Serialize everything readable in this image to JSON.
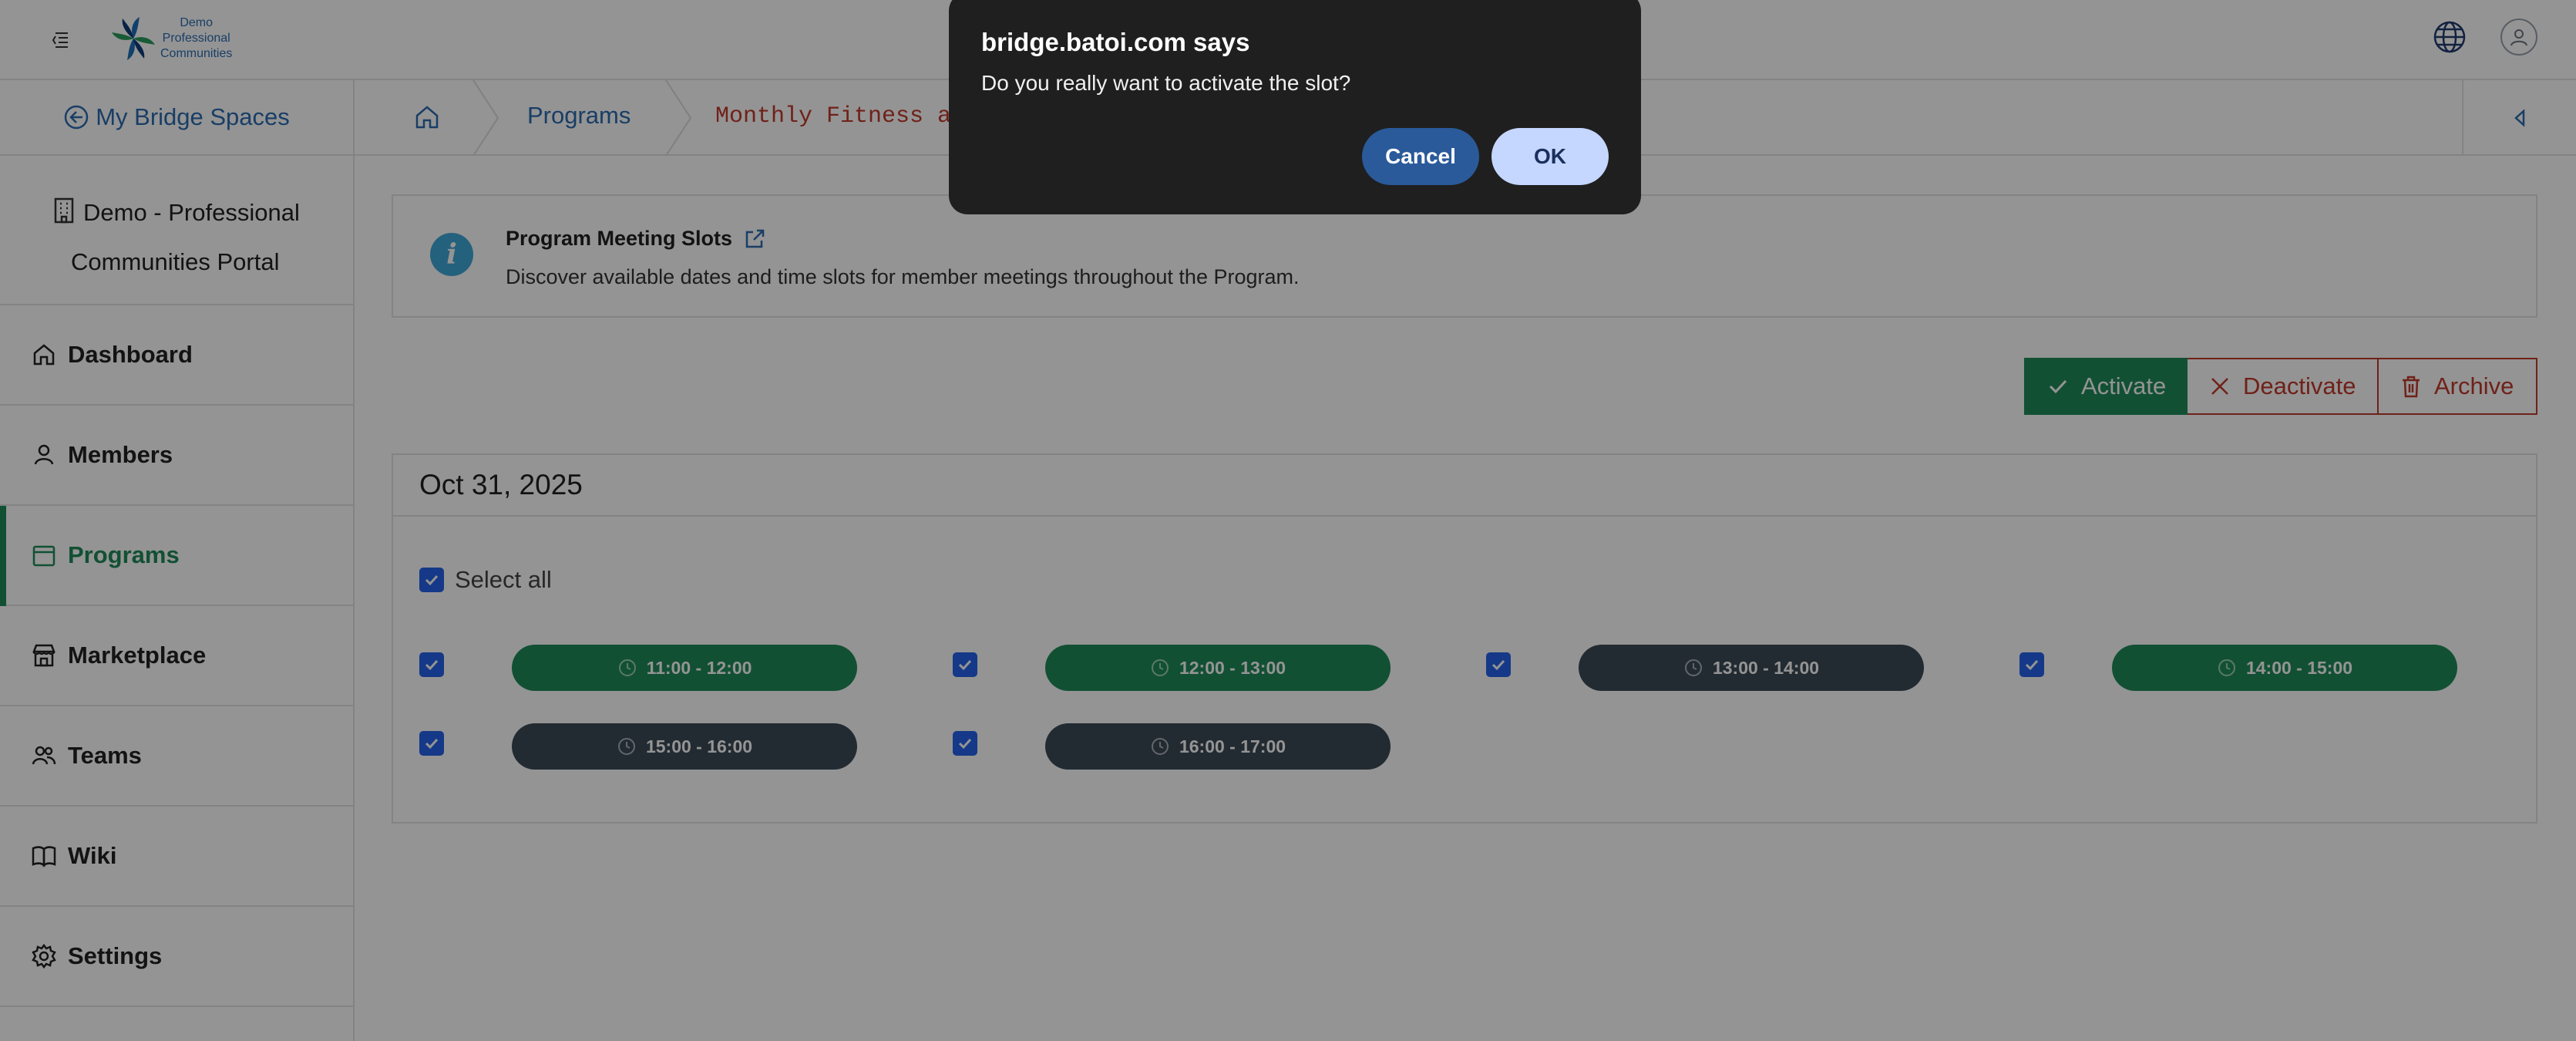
{
  "header": {
    "logo_lines": [
      "Demo",
      "Professional",
      "Communities"
    ],
    "icons": [
      "menu-icon",
      "globe-icon",
      "user-icon"
    ]
  },
  "sidebar": {
    "back_label": "My Bridge Spaces",
    "portal_line1": "Demo - Professional",
    "portal_line2": "Communities Portal",
    "items": [
      {
        "label": "Dashboard",
        "icon": "home-icon"
      },
      {
        "label": "Members",
        "icon": "person-icon"
      },
      {
        "label": "Programs",
        "icon": "calendar-icon",
        "active": true
      },
      {
        "label": "Marketplace",
        "icon": "store-icon"
      },
      {
        "label": "Teams",
        "icon": "people-icon"
      },
      {
        "label": "Wiki",
        "icon": "book-icon"
      },
      {
        "label": "Settings",
        "icon": "gear-icon"
      }
    ]
  },
  "breadcrumb": {
    "programs": "Programs",
    "current": "Monthly Fitness an"
  },
  "info": {
    "title": "Program Meeting Slots",
    "description": "Discover available dates and time slots for member meetings throughout the Program."
  },
  "actions": {
    "activate": "Activate",
    "deactivate": "Deactivate",
    "archive": "Archive"
  },
  "date_group": {
    "date": "Oct 31, 2025",
    "select_all": "Select all",
    "slots": [
      {
        "time": "11:00 - 12:00",
        "status": "active",
        "checked": true
      },
      {
        "time": "12:00 - 13:00",
        "status": "active",
        "checked": true
      },
      {
        "time": "13:00 - 14:00",
        "status": "inactive",
        "checked": true
      },
      {
        "time": "14:00 - 15:00",
        "status": "active",
        "checked": true
      },
      {
        "time": "15:00 - 16:00",
        "status": "inactive",
        "checked": true
      },
      {
        "time": "16:00 - 17:00",
        "status": "inactive",
        "checked": true
      }
    ]
  },
  "dialog": {
    "title": "bridge.batoi.com says",
    "message": "Do you really want to activate the slot?",
    "cancel": "Cancel",
    "ok": "OK"
  },
  "colors": {
    "brand_green": "#1f8a5b",
    "link_blue": "#2b6cb0",
    "danger_red": "#c0392b",
    "slot_inactive": "#3d4a57",
    "checkbox_blue": "#2563eb"
  }
}
